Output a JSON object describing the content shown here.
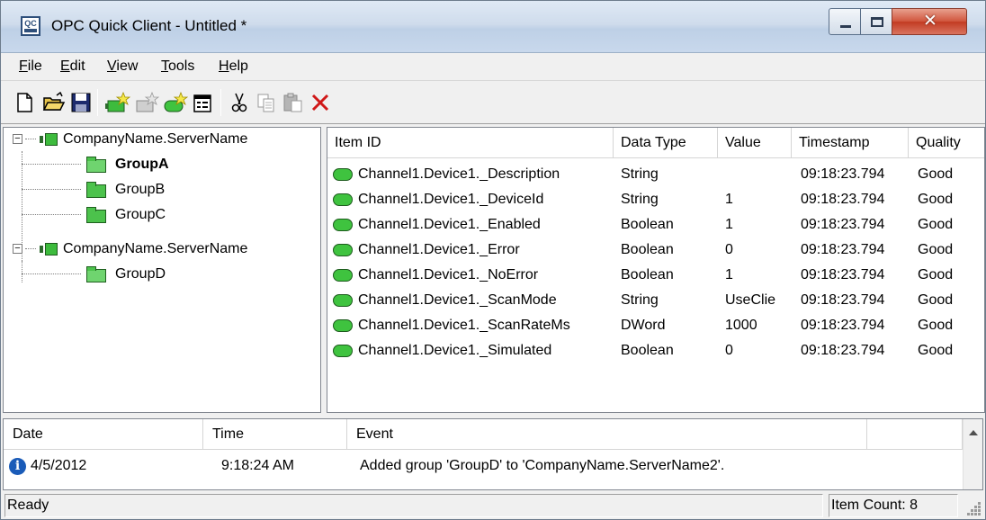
{
  "window": {
    "title": "OPC Quick Client - Untitled *",
    "icon_text": "QC",
    "close_glyph": "✕"
  },
  "menu": [
    {
      "key": "F",
      "rest": "ile"
    },
    {
      "key": "E",
      "rest": "dit"
    },
    {
      "key": "V",
      "rest": "iew"
    },
    {
      "key": "T",
      "rest": "ools"
    },
    {
      "key": "H",
      "rest": "elp"
    }
  ],
  "toolbar": {
    "icons": [
      "new-file-icon",
      "open-folder-icon",
      "save-icon",
      "new-server-connection-icon",
      "new-group-icon",
      "new-item-icon",
      "properties-icon",
      "cut-icon",
      "copy-icon",
      "paste-icon",
      "delete-icon"
    ]
  },
  "tree": {
    "servers": [
      {
        "label": "CompanyName.ServerName",
        "groups": [
          "GroupA",
          "GroupB",
          "GroupC"
        ],
        "selected": "GroupA"
      },
      {
        "label": "CompanyName.ServerName",
        "groups": [
          "GroupD"
        ]
      }
    ]
  },
  "items": {
    "columns": [
      "Item ID",
      "Data Type",
      "Value",
      "Timestamp",
      "Quality"
    ],
    "rows": [
      {
        "id": "Channel1.Device1._Description",
        "type": "String",
        "value": "",
        "timestamp": "09:18:23.794",
        "quality": "Good"
      },
      {
        "id": "Channel1.Device1._DeviceId",
        "type": "String",
        "value": "1",
        "timestamp": "09:18:23.794",
        "quality": "Good"
      },
      {
        "id": "Channel1.Device1._Enabled",
        "type": "Boolean",
        "value": "1",
        "timestamp": "09:18:23.794",
        "quality": "Good"
      },
      {
        "id": "Channel1.Device1._Error",
        "type": "Boolean",
        "value": "0",
        "timestamp": "09:18:23.794",
        "quality": "Good"
      },
      {
        "id": "Channel1.Device1._NoError",
        "type": "Boolean",
        "value": "1",
        "timestamp": "09:18:23.794",
        "quality": "Good"
      },
      {
        "id": "Channel1.Device1._ScanMode",
        "type": "String",
        "value": "UseClie",
        "timestamp": "09:18:23.794",
        "quality": "Good"
      },
      {
        "id": "Channel1.Device1._ScanRateMs",
        "type": "DWord",
        "value": "1000",
        "timestamp": "09:18:23.794",
        "quality": "Good"
      },
      {
        "id": "Channel1.Device1._Simulated",
        "type": "Boolean",
        "value": "0",
        "timestamp": "09:18:23.794",
        "quality": "Good"
      }
    ]
  },
  "events": {
    "columns": [
      "Date",
      "Time",
      "Event"
    ],
    "rows": [
      {
        "date": "4/5/2012",
        "time": "9:18:24 AM",
        "event": "Added group 'GroupD' to 'CompanyName.ServerName2'.",
        "icon": "info-icon"
      }
    ]
  },
  "status": {
    "left": "Ready",
    "right": "Item Count: 8"
  },
  "colors": {
    "tag_green": "#3fc33f",
    "titlebar": "#cfdcec",
    "close_button": "#c23b22"
  }
}
